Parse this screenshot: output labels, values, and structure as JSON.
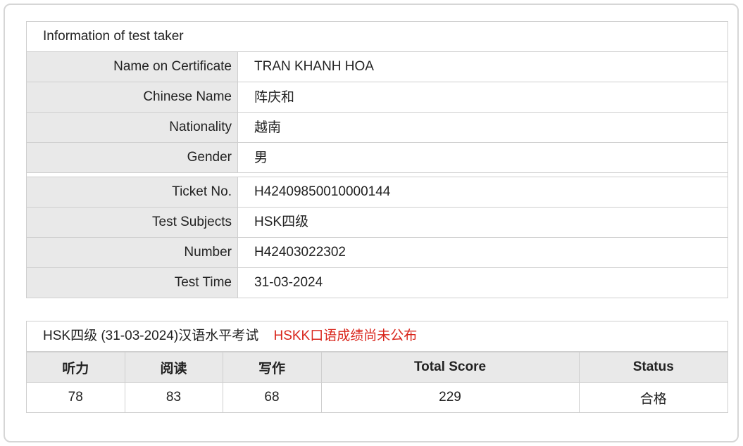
{
  "info": {
    "title": "Information of test taker",
    "rows": [
      {
        "label": "Name on Certificate",
        "value": "TRAN KHANH HOA"
      },
      {
        "label": "Chinese Name",
        "value": "阵庆和"
      },
      {
        "label": "Nationality",
        "value": "越南"
      },
      {
        "label": "Gender",
        "value": "男"
      }
    ],
    "rows2": [
      {
        "label": "Ticket No.",
        "value": "H42409850010000144"
      },
      {
        "label": "Test Subjects",
        "value": "HSK四级"
      },
      {
        "label": "Number",
        "value": "H42403022302"
      },
      {
        "label": "Test Time",
        "value": "31-03-2024"
      }
    ]
  },
  "score": {
    "title": "HSK四级 (31-03-2024)汉语水平考试",
    "notice": "HSKK口语成绩尚未公布",
    "headers": [
      "听力",
      "阅读",
      "写作",
      "Total Score",
      "Status"
    ],
    "values": [
      "78",
      "83",
      "68",
      "229",
      "合格"
    ]
  },
  "colors": {
    "notice": "#d9261c",
    "label_bg": "#e9e9e9",
    "border": "#cfcfcf"
  }
}
